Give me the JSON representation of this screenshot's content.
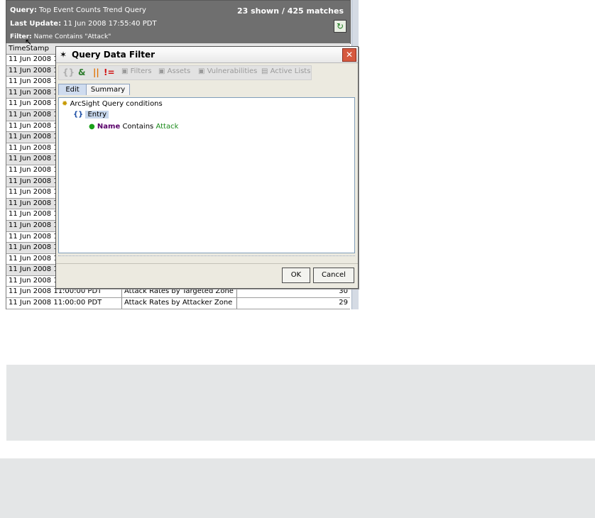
{
  "query_panel": {
    "query_label": "Query:",
    "query_value": "Top Event Counts Trend Query",
    "shown": "23 shown / 425 matches",
    "last_update_label": "Last Update:",
    "last_update_value": "11 Jun 2008 17:55:40 PDT",
    "filter_label": "Filter:",
    "filter_value": "Name Contains \"Attack\""
  },
  "table": {
    "header": "TimeStamp",
    "rows_partial": [
      "11 Jun 2008 1",
      "11 Jun 2008 1",
      "11 Jun 2008 1",
      "11 Jun 2008 1",
      "11 Jun 2008 1",
      "11 Jun 2008 1",
      "11 Jun 2008 1",
      "11 Jun 2008 1",
      "11 Jun 2008 1",
      "11 Jun 2008 1",
      "11 Jun 2008 1",
      "11 Jun 2008 1",
      "11 Jun 2008 1",
      "11 Jun 2008 1",
      "11 Jun 2008 1",
      "11 Jun 2008 1",
      "11 Jun 2008 1",
      "11 Jun 2008 1",
      "11 Jun 2008 1",
      "11 Jun 2008 1",
      "11 Jun 2008 1"
    ],
    "row_22": {
      "time": "11 Jun 2008 11:00:00 PDT",
      "name": "Attack Rates by Targeted Zone",
      "count": "30"
    },
    "row_23": {
      "time": "11 Jun 2008 11:00:00 PDT",
      "name": "Attack Rates by Attacker Zone",
      "count": "29"
    }
  },
  "dialog": {
    "title": "Query Data Filter",
    "toolbar": {
      "filters": "Filters",
      "assets": "Assets",
      "vulnerabilities": "Vulnerabilities",
      "active_lists": "Active Lists"
    },
    "tabs": {
      "edit": "Edit",
      "summary": "Summary"
    },
    "tree": {
      "root": "ArcSight Query conditions",
      "entry": "Entry",
      "leaf_field": "Name",
      "leaf_op": "Contains",
      "leaf_value": "Attack"
    },
    "ok": "OK",
    "cancel": "Cancel"
  }
}
